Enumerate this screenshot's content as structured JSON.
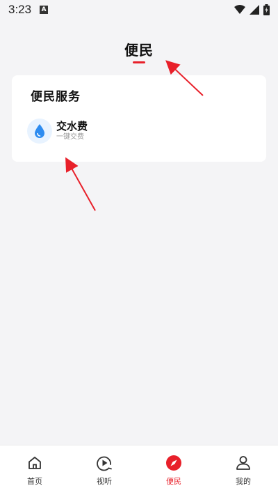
{
  "status_bar": {
    "time": "3:23",
    "notification_icon": "a-icon",
    "icons": [
      "wifi-icon",
      "signal-icon",
      "battery-icon"
    ]
  },
  "header": {
    "title": "便民",
    "accent_color": "#e8202a"
  },
  "service_card": {
    "title": "便民服务",
    "items": [
      {
        "name": "交水费",
        "description": "一键交费",
        "icon": "water-drop-icon",
        "icon_color": "#2d8cf0"
      }
    ]
  },
  "bottom_nav": {
    "items": [
      {
        "label": "首页",
        "icon": "home-icon",
        "active": false
      },
      {
        "label": "视听",
        "icon": "play-icon",
        "active": false
      },
      {
        "label": "便民",
        "icon": "compass-icon",
        "active": true
      },
      {
        "label": "我的",
        "icon": "user-icon",
        "active": false
      }
    ]
  },
  "colors": {
    "background": "#f4f4f6",
    "card": "#ffffff",
    "active": "#e8202a",
    "annotation_arrow": "#e8202a"
  }
}
